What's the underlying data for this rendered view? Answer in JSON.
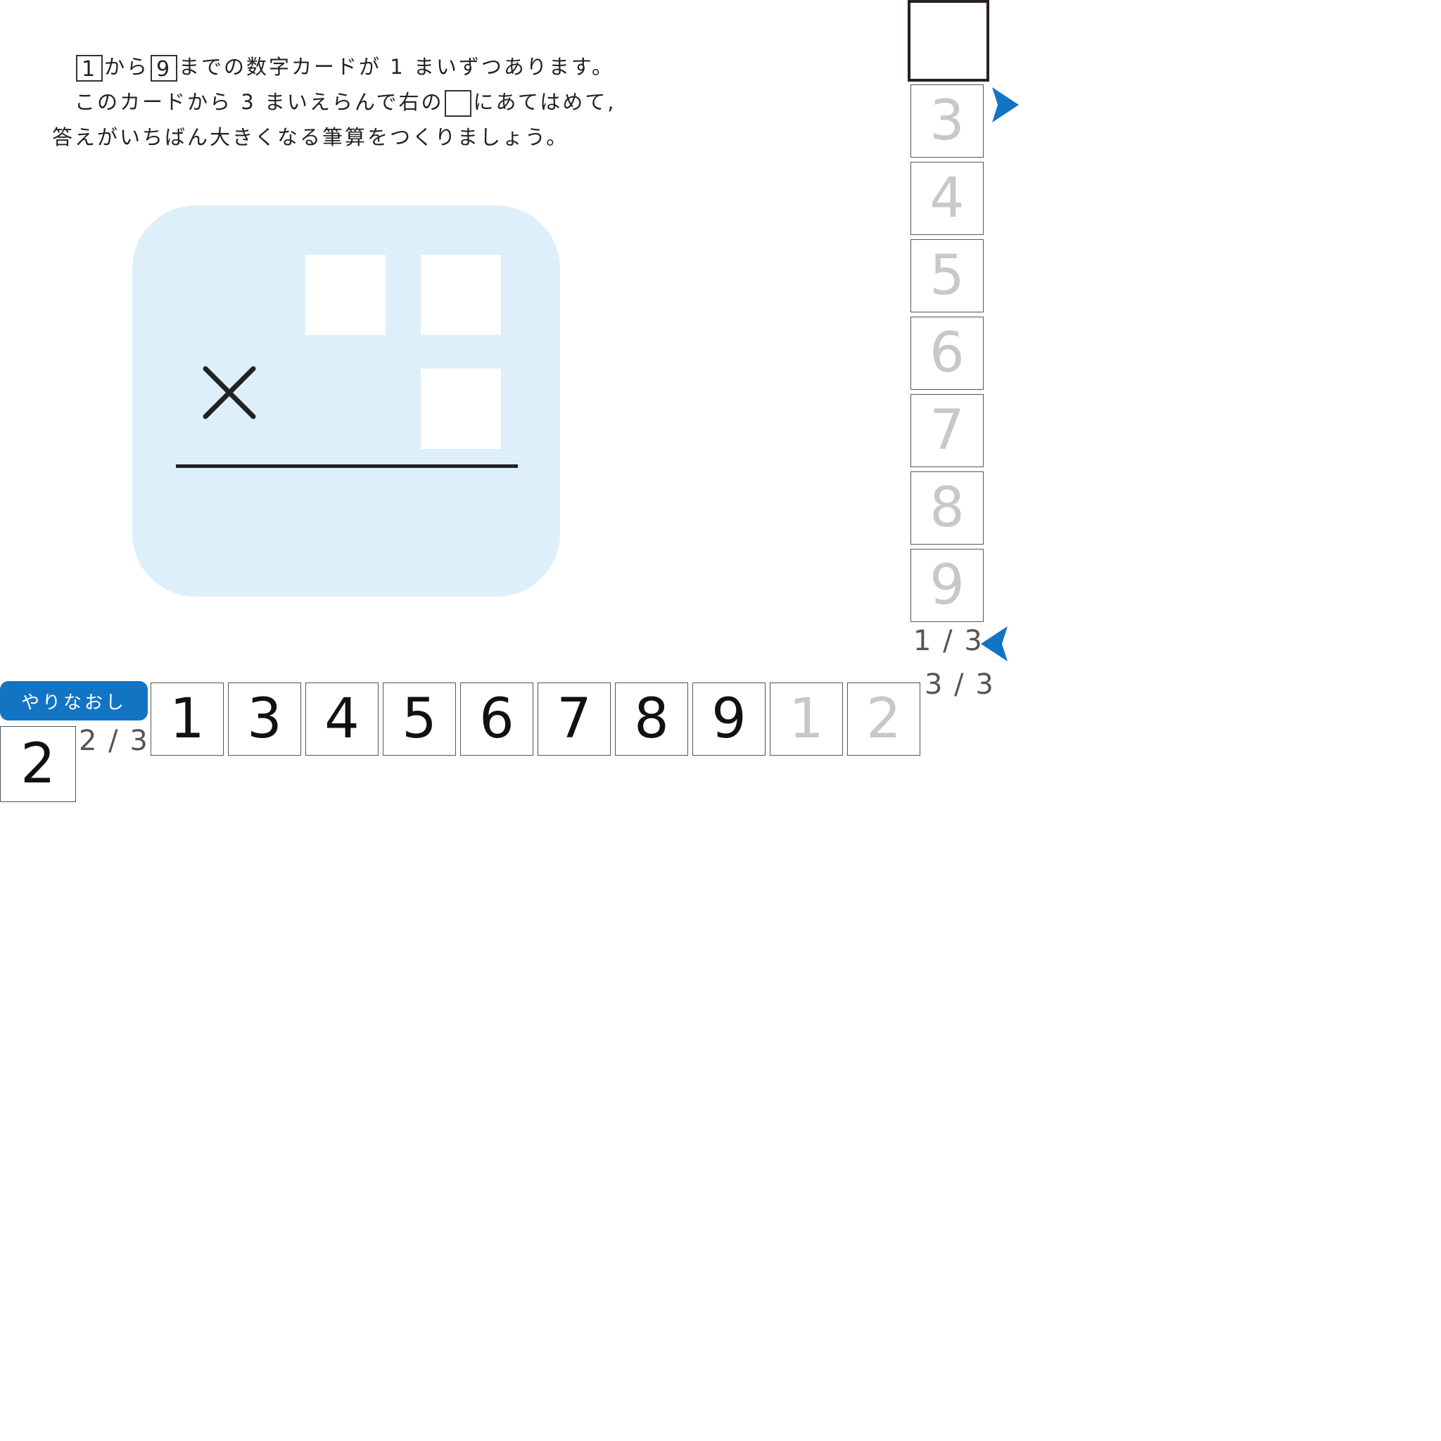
{
  "question": {
    "line1_card_a": "1",
    "line1_text_a": "から",
    "line1_card_b": "9",
    "line1_text_b": "までの数字カードが",
    "line1_count": "1",
    "line1_text_c": "まいずつあります。",
    "line2_text_a": "このカードから",
    "line2_count": "3",
    "line2_text_b": "まいえらんで右の",
    "line2_text_c": "にあてはめて,",
    "line3_text": "答えがいちばん大きくなる筆算をつくりましょう。"
  },
  "vertical_strip": {
    "cards": [
      {
        "label": "3",
        "state": "used"
      },
      {
        "label": "4",
        "state": "used"
      },
      {
        "label": "5",
        "state": "used"
      },
      {
        "label": "6",
        "state": "used"
      },
      {
        "label": "7",
        "state": "used"
      },
      {
        "label": "8",
        "state": "used"
      },
      {
        "label": "9",
        "state": "used"
      }
    ],
    "pager": "1 / 3"
  },
  "horizontal_strip": {
    "cards": [
      {
        "label": "1",
        "state": "available"
      },
      {
        "label": "3",
        "state": "available"
      },
      {
        "label": "4",
        "state": "available"
      },
      {
        "label": "5",
        "state": "available"
      },
      {
        "label": "6",
        "state": "available"
      },
      {
        "label": "7",
        "state": "available"
      },
      {
        "label": "8",
        "state": "available"
      },
      {
        "label": "9",
        "state": "available"
      },
      {
        "label": "1",
        "state": "used"
      },
      {
        "label": "2",
        "state": "used"
      }
    ],
    "pager": "3 / 3"
  },
  "small_strip": {
    "card": "2",
    "pager": "2 / 3"
  },
  "reset_button": {
    "label": "やりなおし"
  },
  "colors": {
    "accent": "#1474c4",
    "work_area": "#ddeffa",
    "used_digit": "#c8c8c8"
  }
}
